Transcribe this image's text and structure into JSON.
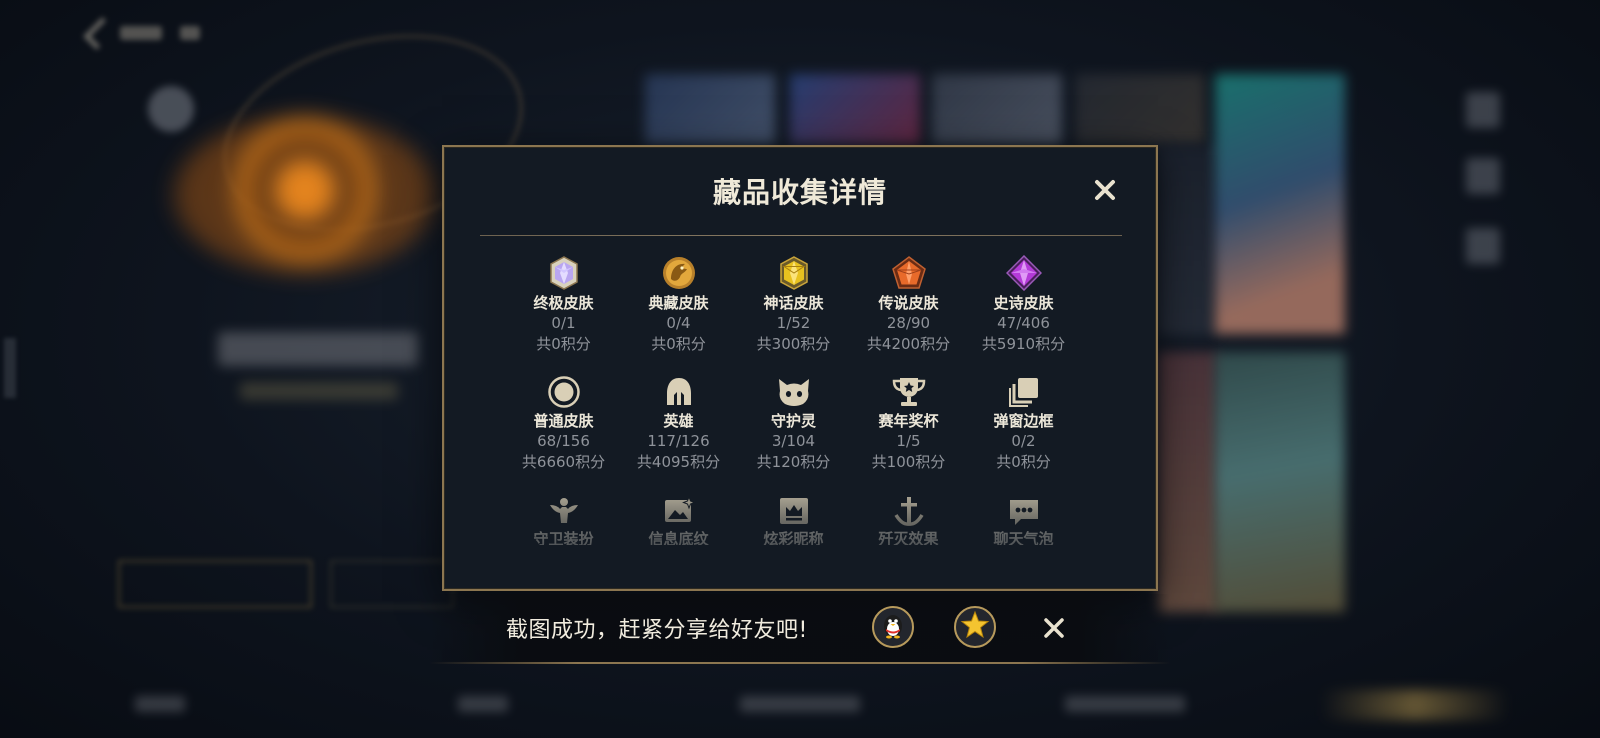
{
  "modal": {
    "title": "藏品收集详情",
    "close_icon": "close-icon",
    "rows": [
      [
        {
          "key": "ultimate",
          "icon": "ultimate-skin-gem-icon",
          "name": "终极皮肤",
          "count": "0/1",
          "points": "共0积分",
          "color": "#b9a6f0"
        },
        {
          "key": "collection",
          "icon": "collection-skin-dragon-icon",
          "name": "典藏皮肤",
          "count": "0/4",
          "points": "共0积分",
          "color": "#e0a93a"
        },
        {
          "key": "mythic",
          "icon": "mythic-skin-gem-icon",
          "name": "神话皮肤",
          "count": "1/52",
          "points": "共300积分",
          "color": "#e8c21f"
        },
        {
          "key": "legend",
          "icon": "legend-skin-gem-icon",
          "name": "传说皮肤",
          "count": "28/90",
          "points": "共4200积分",
          "color": "#e86a2a"
        },
        {
          "key": "epic",
          "icon": "epic-skin-gem-icon",
          "name": "史诗皮肤",
          "count": "47/406",
          "points": "共5910积分",
          "color": "#b43ad8"
        }
      ],
      [
        {
          "key": "normal",
          "icon": "normal-skin-circle-icon",
          "name": "普通皮肤",
          "count": "68/156",
          "points": "共6660积分",
          "color": "#d9cfb6"
        },
        {
          "key": "hero",
          "icon": "hero-helmet-icon",
          "name": "英雄",
          "count": "117/126",
          "points": "共4095积分",
          "color": "#d9cfb6"
        },
        {
          "key": "spirit",
          "icon": "guardian-spirit-icon",
          "name": "守护灵",
          "count": "3/104",
          "points": "共120积分",
          "color": "#d9cfb6"
        },
        {
          "key": "trophy",
          "icon": "season-trophy-icon",
          "name": "赛年奖杯",
          "count": "1/5",
          "points": "共100积分",
          "color": "#d9cfb6"
        },
        {
          "key": "frame",
          "icon": "popup-frame-icon",
          "name": "弹窗边框",
          "count": "0/2",
          "points": "共0积分",
          "color": "#d9cfb6"
        }
      ],
      [
        {
          "key": "guard",
          "icon": "guard-outfit-icon",
          "name": "守卫装扮",
          "count": "",
          "points": "",
          "color": "#d9cfb6"
        },
        {
          "key": "info",
          "icon": "info-pattern-icon",
          "name": "信息底纹",
          "count": "",
          "points": "",
          "color": "#d9cfb6"
        },
        {
          "key": "nickname",
          "icon": "colorful-nickname-icon",
          "name": "炫彩昵称",
          "count": "",
          "points": "",
          "color": "#d9cfb6"
        },
        {
          "key": "kill",
          "icon": "kill-effect-icon",
          "name": "歼灭效果",
          "count": "",
          "points": "",
          "color": "#d9cfb6"
        },
        {
          "key": "chat",
          "icon": "chat-bubble-icon",
          "name": "聊天气泡",
          "count": "",
          "points": "",
          "color": "#d9cfb6"
        }
      ]
    ]
  },
  "toast": {
    "message": "截图成功，赶紧分享给好友吧!",
    "share_qq_icon": "qq-penguin-icon",
    "share_qzone_icon": "qzone-star-icon",
    "close_icon": "close-icon"
  },
  "colors": {
    "accent_gold": "#8c7650",
    "panel_bg": "#131a23",
    "text_primary": "#ece7d9",
    "text_muted": "#8f939a"
  }
}
